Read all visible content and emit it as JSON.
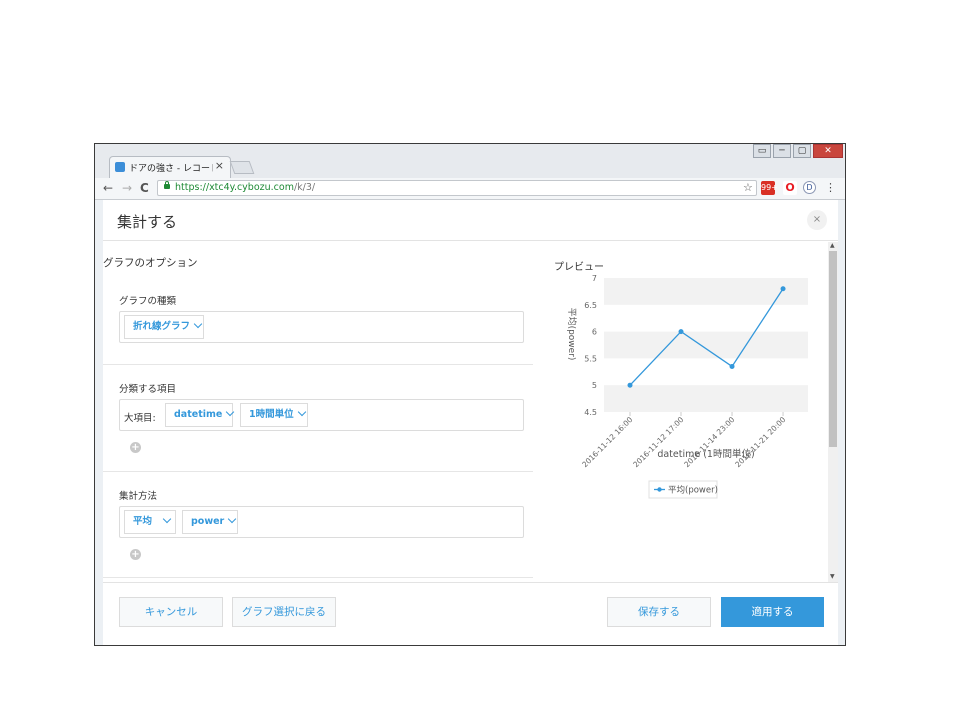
{
  "browser": {
    "tab_title": "ドアの強さ - レコードの",
    "tab_close": "×",
    "window_buttons": [
      "▭",
      "─",
      "▢",
      "✕"
    ],
    "url_scheme": "https://",
    "url_host": "xtc4y.cybozu.com",
    "url_path": "/k/3/",
    "back_icon": "←",
    "forward_icon": "→",
    "reload_icon": "C",
    "star_icon": "☆",
    "menu_icon": "⋮",
    "extensions": [
      {
        "name": "pdf-extension-icon",
        "label": "99+",
        "color": "#d93025"
      },
      {
        "name": "opera-icon",
        "label": "O",
        "color": "#e81c24"
      },
      {
        "name": "dashlane-icon",
        "label": "D",
        "color": "#3b5998"
      }
    ]
  },
  "dialog": {
    "title": "集計する",
    "close_icon": "×",
    "options_heading": "グラフのオプション",
    "chart_type": {
      "label": "グラフの種類",
      "value": "折れ線グラフ"
    },
    "grouping": {
      "label": "分類する項目",
      "major_label": "大項目:",
      "field": "datetime",
      "unit": "1時間単位"
    },
    "aggregation": {
      "label": "集計方法",
      "function": "平均",
      "field": "power"
    },
    "add_icon": "+",
    "preview_label": "プレビュー",
    "buttons": {
      "cancel": "キャンセル",
      "back": "グラフ選択に戻る",
      "save": "保存する",
      "apply": "適用する"
    }
  },
  "colors": {
    "accent": "#3498db",
    "series": "#3498db",
    "band": "#f2f2f2",
    "close_red": "#c9463d"
  },
  "chart_data": {
    "type": "line",
    "categories": [
      "2016-11-12 16:00",
      "2016-11-12 17:00",
      "2016-11-14 23:00",
      "2016-11-21 20:00"
    ],
    "series": [
      {
        "name": "平均(power)",
        "values": [
          5.0,
          6.0,
          5.35,
          6.8
        ]
      }
    ],
    "xlabel": "datetime (1時間単位)",
    "ylabel": "平均(power)",
    "ylim": [
      4.5,
      7
    ],
    "yticks": [
      "4.5",
      "5",
      "5.5",
      "6",
      "6.5",
      "7"
    ],
    "legend": "bottom-center",
    "grid": "alternating bands"
  }
}
